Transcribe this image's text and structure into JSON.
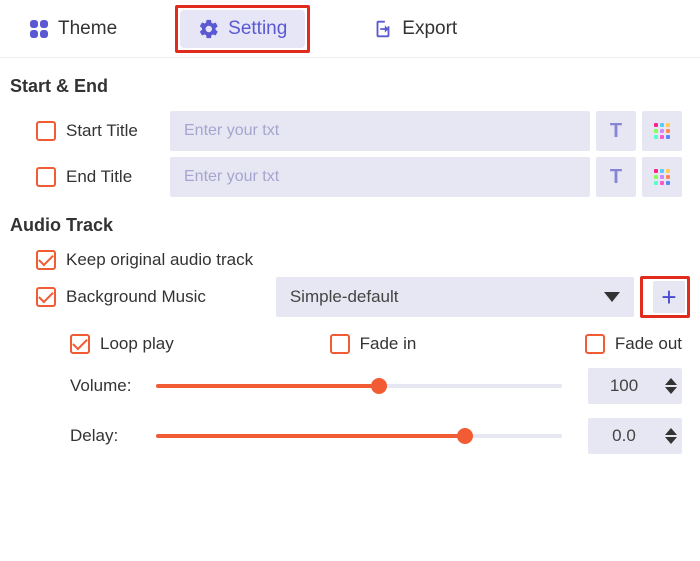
{
  "tabs": {
    "theme": "Theme",
    "setting": "Setting",
    "export": "Export",
    "active": "setting"
  },
  "sections": {
    "start_end": "Start & End",
    "audio_track": "Audio Track"
  },
  "start_end": {
    "start_title_label": "Start Title",
    "start_title_value": "",
    "start_title_placeholder": "Enter your txt",
    "end_title_label": "End Title",
    "end_title_value": "",
    "end_title_placeholder": "Enter your txt"
  },
  "audio": {
    "keep_original_label": "Keep original audio track",
    "keep_original_checked": true,
    "bg_music_label": "Background Music",
    "bg_music_checked": true,
    "bg_music_selected": "Simple-default",
    "loop_play_label": "Loop play",
    "loop_play_checked": true,
    "fade_in_label": "Fade in",
    "fade_in_checked": false,
    "fade_out_label": "Fade out",
    "fade_out_checked": false,
    "volume_label": "Volume:",
    "volume_value": "100",
    "volume_percent": 55,
    "delay_label": "Delay:",
    "delay_value": "0.0",
    "delay_percent": 76
  },
  "icons": {
    "text_btn": "T"
  }
}
